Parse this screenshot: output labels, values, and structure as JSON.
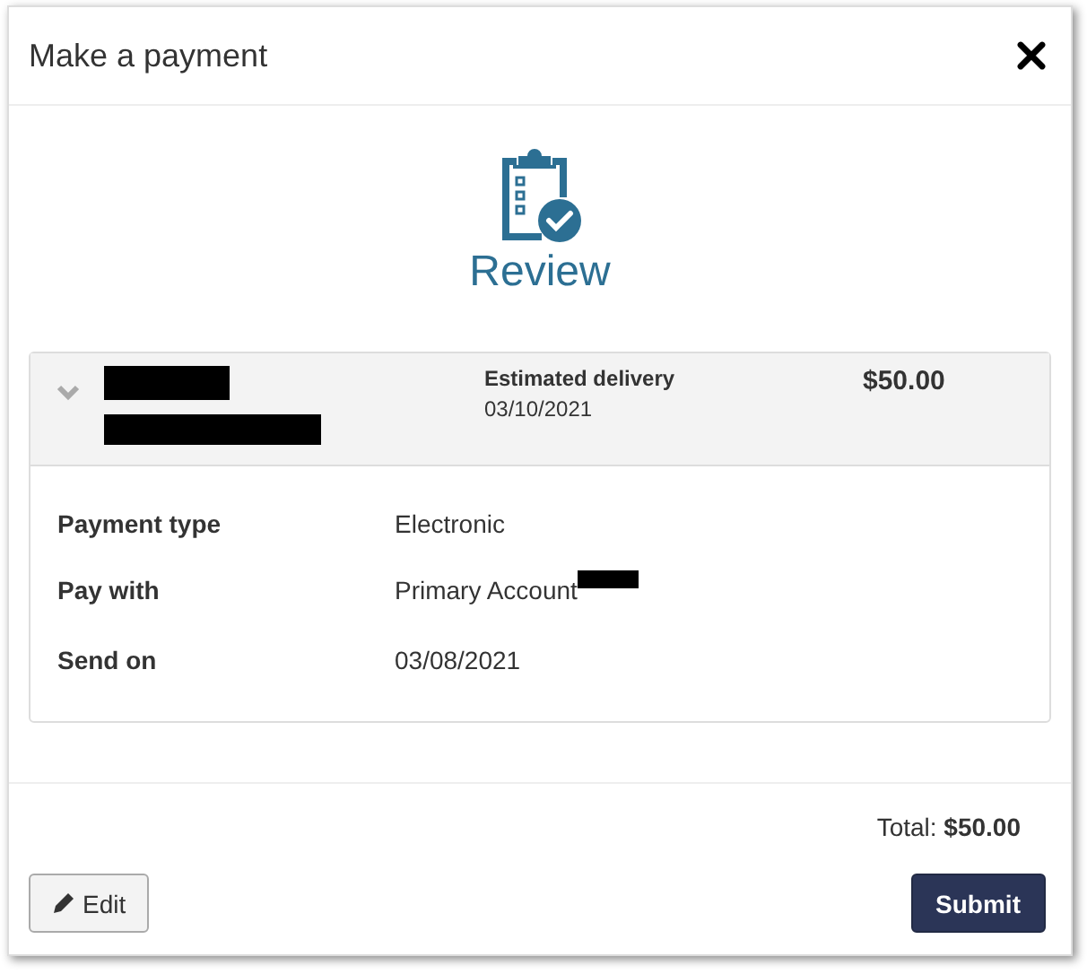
{
  "dialog": {
    "title": "Make a payment"
  },
  "step": {
    "label": "Review"
  },
  "summary": {
    "delivery_label": "Estimated delivery",
    "delivery_date": "03/10/2021",
    "amount": "$50.00"
  },
  "details": [
    {
      "label": "Payment type",
      "value": "Electronic",
      "redacted": false
    },
    {
      "label": "Pay with",
      "value": "Primary Account",
      "redacted": true
    },
    {
      "label": "Send on",
      "value": "03/08/2021",
      "redacted": false
    }
  ],
  "total": "Total: **$50.00**",
  "buttons": {
    "edit": "Edit",
    "submit": "Submit"
  }
}
